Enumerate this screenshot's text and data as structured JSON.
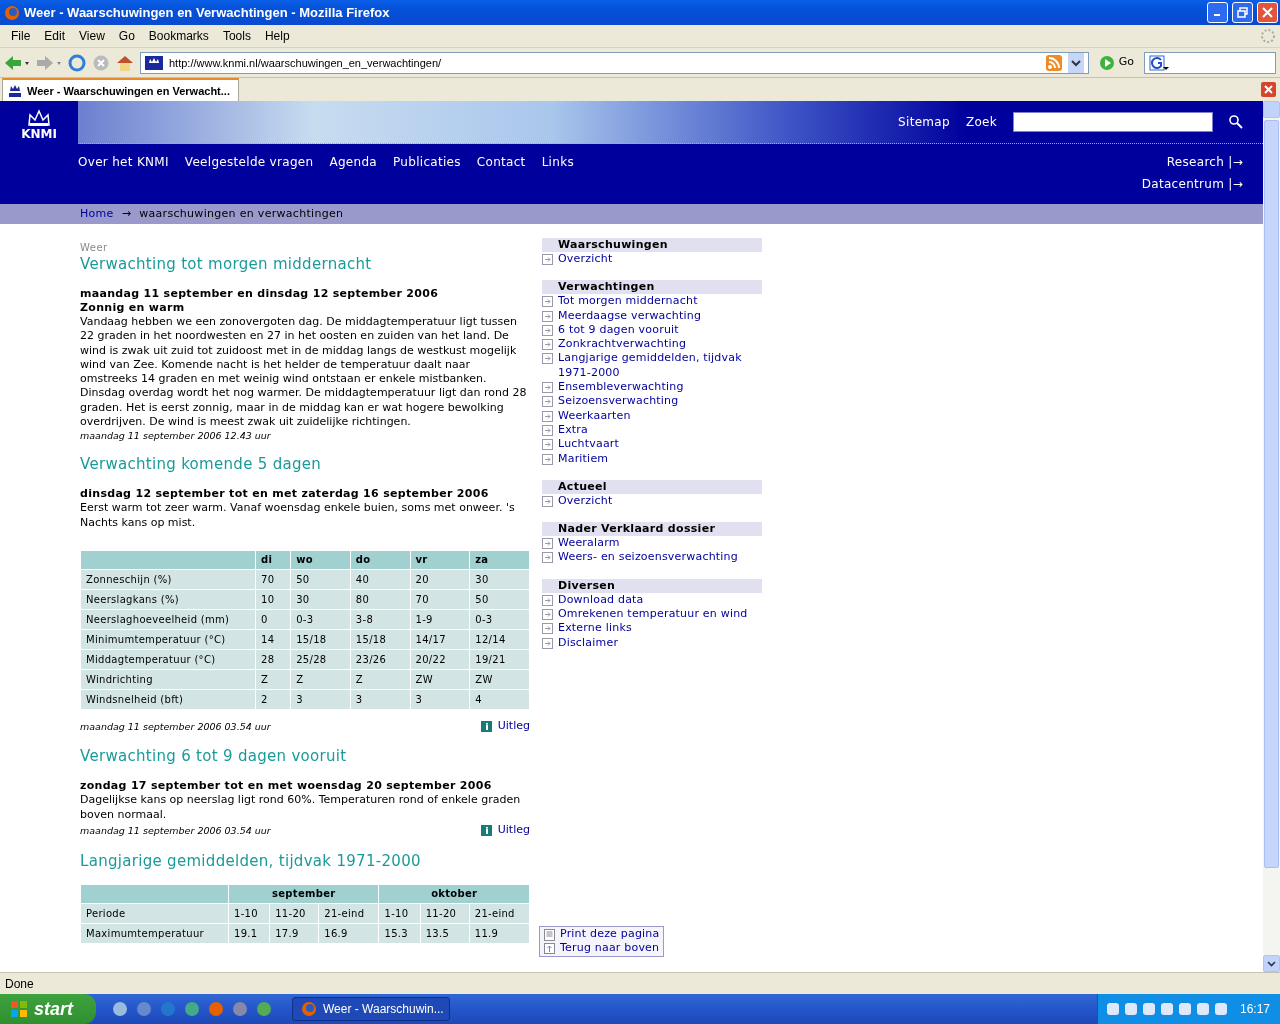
{
  "window": {
    "title": "Weer - Waarschuwingen en Verwachtingen - Mozilla Firefox"
  },
  "menu": [
    "File",
    "Edit",
    "View",
    "Go",
    "Bookmarks",
    "Tools",
    "Help"
  ],
  "address_bar": {
    "url": "http://www.knmi.nl/waarschuwingen_en_verwachtingen/"
  },
  "go_button": "Go",
  "tabs": [
    {
      "label": "Weer - Waarschuwingen en Verwacht...",
      "selected": true
    }
  ],
  "header": {
    "logo": "KNMI",
    "top_links": [
      "Sitemap",
      "Zoek"
    ],
    "nav": [
      "Over het KNMI",
      "Veelgestelde vragen",
      "Agenda",
      "Publicaties",
      "Contact",
      "Links"
    ],
    "side_links": [
      "Research |→",
      "Datacentrum |→"
    ]
  },
  "breadcrumb": {
    "home": "Home",
    "separator": "→",
    "current": "waarschuwingen en verwachtingen"
  },
  "main": {
    "section_label": "Weer",
    "sections": [
      {
        "kind": "text",
        "title": "Verwachting tot morgen middernacht",
        "date": "maandag 11 september en dinsdag 12 september 2006",
        "subtitle": "Zonnig en warm",
        "body": "Vandaag hebben we een zonovergoten dag. De middagtemperatuur ligt tussen 22 graden in het noordwesten en 27 in het oosten en zuiden van het land. De wind is zwak uit zuid tot zuidoost met in de middag langs de westkust mogelijk wind van Zee. Komende nacht is het helder de temperatuur daalt naar omstreeks 14 graden en met weinig wind ontstaan er enkele mistbanken. Dinsdag overdag wordt het nog warmer. De middagtemperatuur ligt dan rond 28 graden. Het is eerst zonnig, maar in de middag kan er wat hogere bewolking overdrijven. De wind is meest zwak uit zuidelijke richtingen.",
        "timestamp": "maandag 11 september 2006 12.43 uur"
      },
      {
        "kind": "table",
        "title": "Verwachting komende 5 dagen",
        "date": "dinsdag 12 september tot en met zaterdag 16 september 2006",
        "body": "Eerst warm tot zeer warm. Vanaf woensdag enkele buien, soms met onweer. 's Nachts kans op mist.",
        "table": {
          "columns": [
            "",
            "di",
            "wo",
            "do",
            "vr",
            "za"
          ],
          "rows": [
            [
              "Zonneschijn (%)",
              "70",
              "50",
              "40",
              "20",
              "30"
            ],
            [
              "Neerslagkans (%)",
              "10",
              "30",
              "80",
              "70",
              "50"
            ],
            [
              "Neerslaghoeveelheid (mm)",
              "0",
              "0-3",
              "3-8",
              "1-9",
              "0-3"
            ],
            [
              "Minimumtemperatuur (°C)",
              "14",
              "15/18",
              "15/18",
              "14/17",
              "12/14"
            ],
            [
              "Middagtemperatuur (°C)",
              "28",
              "25/28",
              "23/26",
              "20/22",
              "19/21"
            ],
            [
              "Windrichting",
              "Z",
              "Z",
              "Z",
              "ZW",
              "ZW"
            ],
            [
              "Windsnelheid (bft)",
              "2",
              "3",
              "3",
              "3",
              "4"
            ]
          ]
        },
        "timestamp": "maandag 11 september 2006 03.54 uur",
        "info_link": "Uitleg"
      },
      {
        "kind": "text",
        "title": "Verwachting 6 tot 9 dagen vooruit",
        "date": "zondag 17 september tot en met woensdag 20 september 2006",
        "body": "Dagelijkse kans op neerslag ligt rond 60%. Temperaturen rond of enkele graden boven normaal.",
        "timestamp": "maandag 11 september 2006 03.54 uur",
        "info_link": "Uitleg"
      },
      {
        "kind": "grouped_table",
        "title": "Langjarige gemiddelden, tijdvak 1971-2000",
        "table": {
          "groups": [
            "september",
            "oktober"
          ],
          "rows": [
            [
              "Periode",
              "1-10",
              "11-20",
              "21-eind",
              "1-10",
              "11-20",
              "21-eind"
            ],
            [
              "Maximumtemperatuur",
              "19.1",
              "17.9",
              "16.9",
              "15.3",
              "13.5",
              "11.9"
            ]
          ]
        }
      }
    ]
  },
  "sidebar": {
    "groups": [
      {
        "title": "Waarschuwingen",
        "items": [
          "Overzicht"
        ]
      },
      {
        "title": "Verwachtingen",
        "items": [
          "Tot morgen middernacht",
          "Meerdaagse verwachting",
          "6 tot 9 dagen vooruit",
          "Zonkrachtverwachting",
          "Langjarige gemiddelden, tijdvak 1971-2000",
          "Ensembleverwachting",
          "Seizoensverwachting",
          "Weerkaarten",
          "Extra",
          "Luchtvaart",
          "Maritiem"
        ]
      },
      {
        "title": "Actueel",
        "items": [
          "Overzicht"
        ]
      },
      {
        "title": "Nader Verklaard dossier",
        "items": [
          "Weeralarm",
          "Weers- en seizoensverwachting"
        ]
      },
      {
        "title": "Diversen",
        "items": [
          "Download data",
          "Omrekenen temperatuur en wind",
          "Externe links",
          "Disclaimer"
        ]
      }
    ],
    "page_tools": [
      {
        "kind": "print",
        "label": "Print deze pagina"
      },
      {
        "kind": "top",
        "label": "Terug naar boven"
      }
    ]
  },
  "status_bar": "Done",
  "taskbar": {
    "start": "start",
    "tasks": [
      {
        "label": "Weer - Waarschuwin...",
        "selected": true
      }
    ],
    "clock": "16:17"
  }
}
